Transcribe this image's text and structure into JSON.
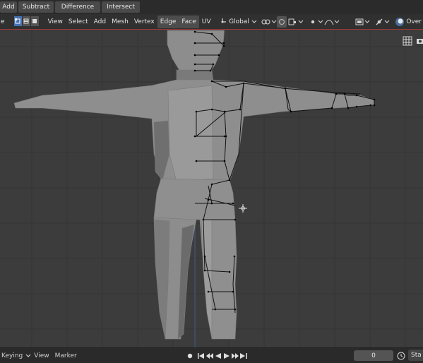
{
  "boolean_bar": {
    "buttons": [
      {
        "label": "Add"
      },
      {
        "label": "Subtract"
      },
      {
        "label": "Difference"
      },
      {
        "label": "Intersect"
      }
    ]
  },
  "header": {
    "mode_label": "e",
    "menus": [
      "View",
      "Select",
      "Add",
      "Mesh",
      "Vertex",
      "Edge",
      "Face",
      "UV"
    ],
    "transform_orientation": "Global",
    "overlays_label": "Over"
  },
  "viewport": {
    "cursor_icon": "3d-cursor-icon"
  },
  "timeline": {
    "keying_label": "Keying",
    "view_label": "View",
    "marker_label": "Marker",
    "current_frame": "0",
    "start_label": "Sta"
  },
  "colors": {
    "accent": "#4772b3",
    "header_line": "#a23b3b",
    "viewport_bg": "#3c3c3c",
    "mesh": "#8f8f8f"
  }
}
